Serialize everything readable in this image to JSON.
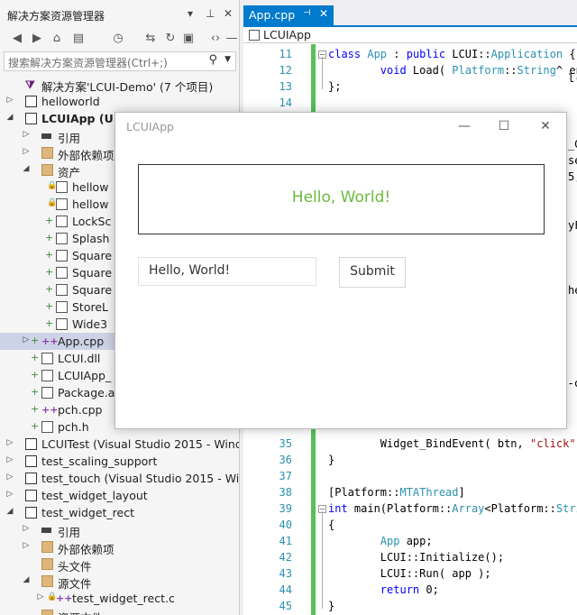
{
  "solution_explorer": {
    "title": "解决方案资源管理器",
    "title_glyphs": [
      "▾",
      "⊥",
      "✕"
    ],
    "search_placeholder": "搜索解决方案资源管理器(Ctrl+;)",
    "tree": [
      {
        "label": "解决方案'LCUI-Demo' (7 个项目)",
        "icon": "solution-icon",
        "level": 0,
        "arrow": ""
      },
      {
        "label": "helloworld",
        "icon": "project-icon",
        "level": 0,
        "arrow": "▷"
      },
      {
        "label": "LCUIApp (U",
        "icon": "project-icon",
        "level": 0,
        "arrow": "◢",
        "bold": true
      },
      {
        "label": "引用",
        "icon": "references-icon",
        "level": 1,
        "arrow": "▷"
      },
      {
        "label": "外部依赖项",
        "icon": "folder-icon",
        "level": 1,
        "arrow": "▷"
      },
      {
        "label": "资产",
        "icon": "folder-icon",
        "level": 1,
        "arrow": "◢"
      },
      {
        "label": "hellow",
        "icon": "file-icon",
        "level": 2,
        "arrow": "",
        "lock": true
      },
      {
        "label": "hellow",
        "icon": "file-icon",
        "level": 2,
        "arrow": "",
        "lock": true
      },
      {
        "label": "LockSc",
        "icon": "image-icon",
        "level": 2,
        "arrow": "",
        "plus": true
      },
      {
        "label": "Splash",
        "icon": "image-icon",
        "level": 2,
        "arrow": "",
        "plus": true
      },
      {
        "label": "Square",
        "icon": "image-icon",
        "level": 2,
        "arrow": "",
        "plus": true
      },
      {
        "label": "Square",
        "icon": "image-icon",
        "level": 2,
        "arrow": "",
        "plus": true
      },
      {
        "label": "Square",
        "icon": "image-icon",
        "level": 2,
        "arrow": "",
        "plus": true
      },
      {
        "label": "StoreL",
        "icon": "image-icon",
        "level": 2,
        "arrow": "",
        "plus": true
      },
      {
        "label": "Wide3",
        "icon": "image-icon",
        "level": 2,
        "arrow": "",
        "plus": true
      },
      {
        "label": "App.cpp",
        "icon": "cpp-file-icon",
        "level": 1,
        "arrow": "▷",
        "plus": true,
        "selected": true
      },
      {
        "label": "LCUI.dll",
        "icon": "dll-icon",
        "level": 1,
        "arrow": "",
        "plus": true
      },
      {
        "label": "LCUIApp_",
        "icon": "file-icon",
        "level": 1,
        "arrow": "",
        "plus": true
      },
      {
        "label": "Package.a",
        "icon": "file-icon",
        "level": 1,
        "arrow": "",
        "plus": true
      },
      {
        "label": "pch.cpp",
        "icon": "cpp-file-icon",
        "level": 1,
        "arrow": "",
        "plus": true
      },
      {
        "label": "pch.h",
        "icon": "header-file-icon",
        "level": 1,
        "arrow": "",
        "plus": true
      },
      {
        "label": "LCUITest (Visual Studio 2015 - Wind",
        "icon": "project-icon",
        "level": 0,
        "arrow": "▷"
      },
      {
        "label": "test_scaling_support",
        "icon": "project-icon",
        "level": 0,
        "arrow": "▷"
      },
      {
        "label": "test_touch (Visual Studio 2015 - Win",
        "icon": "project-icon",
        "level": 0,
        "arrow": "▷"
      },
      {
        "label": "test_widget_layout",
        "icon": "project-icon",
        "level": 0,
        "arrow": "▷"
      },
      {
        "label": "test_widget_rect",
        "icon": "project-icon",
        "level": 0,
        "arrow": "◢"
      },
      {
        "label": "引用",
        "icon": "references-icon",
        "level": 1,
        "arrow": "▷"
      },
      {
        "label": "外部依赖项",
        "icon": "folder-icon",
        "level": 1,
        "arrow": "▷"
      },
      {
        "label": "头文件",
        "icon": "folder-icon",
        "level": 1,
        "arrow": ""
      },
      {
        "label": "源文件",
        "icon": "folder-icon",
        "level": 1,
        "arrow": "◢"
      },
      {
        "label": "test_widget_rect.c",
        "icon": "cpp-file-icon",
        "level": 2,
        "arrow": "▷",
        "lock": true
      },
      {
        "label": "资源文件",
        "icon": "folder-icon",
        "level": 1,
        "arrow": ""
      }
    ]
  },
  "editor": {
    "tab_label": "App.cpp",
    "tab_pin": "⊣",
    "tab_close": "✕",
    "nav_label": "LCUIApp",
    "code_lines": [
      {
        "n": "11",
        "fold": "⊟",
        "tokens": [
          {
            "t": "class ",
            "c": "kw"
          },
          {
            "t": "App",
            "c": "ty"
          },
          {
            "t": " : ",
            "c": ""
          },
          {
            "t": "public ",
            "c": "kw"
          },
          {
            "t": "LCUI::",
            "c": ""
          },
          {
            "t": "Application",
            "c": "ty"
          },
          {
            "t": " {",
            "c": ""
          }
        ]
      },
      {
        "n": "12",
        "fold": "",
        "tokens": [
          {
            "t": "        ",
            "c": ""
          },
          {
            "t": "void ",
            "c": "kw"
          },
          {
            "t": "Load( ",
            "c": ""
          },
          {
            "t": "Platform",
            "c": "ty"
          },
          {
            "t": "::",
            "c": ""
          },
          {
            "t": "String",
            "c": "ty"
          },
          {
            "t": "^ ent",
            "c": ""
          }
        ]
      },
      {
        "n": "13",
        "fold": "",
        "tokens": [
          {
            "t": "};",
            "c": ""
          }
        ]
      },
      {
        "n": "14",
        "fold": "",
        "tokens": []
      },
      {
        "n": "35",
        "fold": "",
        "tokens": [
          {
            "t": "        Widget_BindEvent( btn, ",
            "c": ""
          },
          {
            "t": "\"click\"",
            "c": "st"
          },
          {
            "t": ", ",
            "c": ""
          }
        ]
      },
      {
        "n": "36",
        "fold": "",
        "tokens": [
          {
            "t": "}",
            "c": ""
          }
        ]
      },
      {
        "n": "37",
        "fold": "",
        "tokens": []
      },
      {
        "n": "38",
        "fold": "",
        "tokens": [
          {
            "t": "[Platform::",
            "c": ""
          },
          {
            "t": "MTAThread",
            "c": "ty"
          },
          {
            "t": "]",
            "c": ""
          }
        ]
      },
      {
        "n": "39",
        "fold": "⊟",
        "tokens": [
          {
            "t": "int ",
            "c": "kw"
          },
          {
            "t": "main(Platform::",
            "c": ""
          },
          {
            "t": "Array",
            "c": "ty"
          },
          {
            "t": "<Platform::",
            "c": ""
          },
          {
            "t": "Strin",
            "c": "ty"
          }
        ]
      },
      {
        "n": "40",
        "fold": "",
        "tokens": [
          {
            "t": "{",
            "c": ""
          }
        ]
      },
      {
        "n": "41",
        "fold": "",
        "tokens": [
          {
            "t": "        ",
            "c": ""
          },
          {
            "t": "App",
            "c": "ty"
          },
          {
            "t": " app;",
            "c": ""
          }
        ]
      },
      {
        "n": "42",
        "fold": "",
        "tokens": [
          {
            "t": "        LCUI::Initialize();",
            "c": ""
          }
        ]
      },
      {
        "n": "43",
        "fold": "",
        "tokens": [
          {
            "t": "        LCUI::Run( app );",
            "c": ""
          }
        ]
      },
      {
        "n": "44",
        "fold": "",
        "tokens": [
          {
            "t": "        ",
            "c": ""
          },
          {
            "t": "return ",
            "c": "kw"
          },
          {
            "t": "0;",
            "c": ""
          }
        ]
      },
      {
        "n": "45",
        "fold": "",
        "tokens": [
          {
            "t": "}",
            "c": ""
          }
        ]
      }
    ],
    "fragments": [
      "l(",
      "_Ge",
      "set",
      "5,",
      "yF",
      "he",
      "btn = LCUIWidget_GetById(\"btn-c"
    ]
  },
  "app_window": {
    "title": "LCUIApp",
    "minimize": "—",
    "maximize": "☐",
    "close": "✕",
    "label_text": "Hello, World!",
    "input_value": "Hello, World!",
    "submit_label": "Submit"
  },
  "colors": {
    "accent": "#007acc",
    "green": "#6aba3e",
    "gutter_green": "#57c05a",
    "selection": "#ccd3e6"
  }
}
